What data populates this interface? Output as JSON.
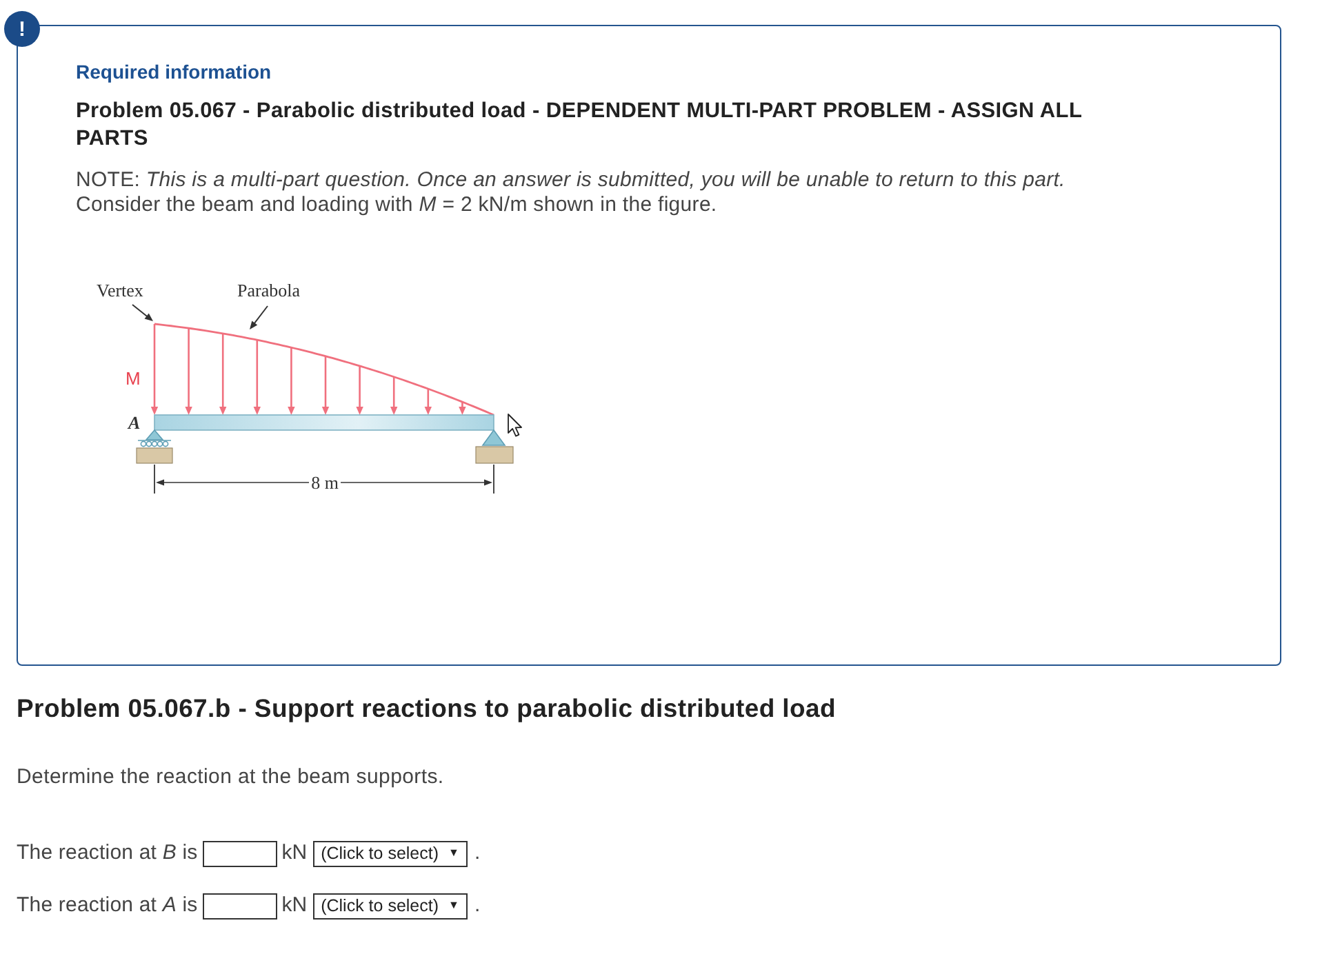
{
  "alert_badge": {
    "symbol": "!"
  },
  "required_information": {
    "label": "Required information",
    "title": "Problem 05.067 - Parabolic distributed load - DEPENDENT MULTI-PART PROBLEM - ASSIGN ALL PARTS",
    "note": "NOTE: *This is a multi-part question. Once an answer is submitted, you will be unable to return to this part.*",
    "given": "Consider the beam and loading with *M* = 2 kN/m shown in the figure.",
    "figure": {
      "vertex_label": "Vertex",
      "parabola_label": "Parabola",
      "load_label": "M",
      "support_label": "A",
      "span_label": "8 m"
    }
  },
  "part": {
    "title": "Problem 05.067.b - Support reactions to parabolic distributed load",
    "prompt": "Determine the reaction at the beam supports.",
    "answers": [
      {
        "label": "The reaction at *B* is",
        "unit": "kN",
        "direction": "(Click to select)",
        "dropdown_arrow": "▼",
        "end": "."
      },
      {
        "label": "The reaction at *A* is",
        "unit": "kN",
        "direction": "(Click to select)",
        "dropdown_arrow": "▼",
        "end": "."
      }
    ]
  }
}
